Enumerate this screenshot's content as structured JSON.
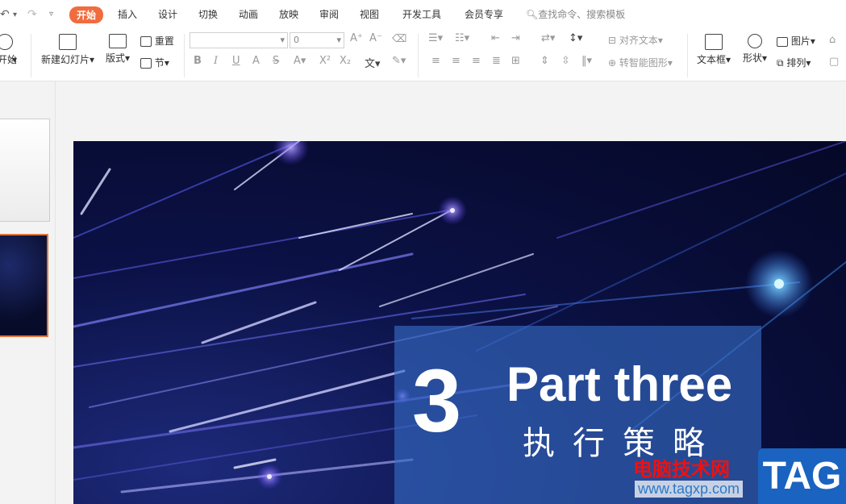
{
  "tabs": [
    "开始",
    "插入",
    "设计",
    "切换",
    "动画",
    "放映",
    "审阅",
    "视图",
    "开发工具",
    "会员专享"
  ],
  "search": {
    "placeholder": "查找命令、搜索模板"
  },
  "ribbon": {
    "start_label": "开始",
    "new_slide_label": "新建幻灯片",
    "layout_label": "版式",
    "reset_label": "重置",
    "section_label": "节",
    "font_size_value": "0",
    "align_text_label": "对齐文本",
    "smart_graphic_label": "转智能图形",
    "textbox_label": "文本框",
    "shape_label": "形状",
    "picture_label": "图片",
    "arrange_label": "排列"
  },
  "slide": {
    "number": "3",
    "title": "Part three",
    "subtitle": "执行策略"
  },
  "watermark": {
    "site_name": "电脑技术网",
    "url": "www.tagxp.com",
    "tag": "TAG"
  },
  "colors": {
    "accent": "#f06c3f",
    "slide_bg": "#0b1145",
    "title_box": "#3b6ec8"
  }
}
